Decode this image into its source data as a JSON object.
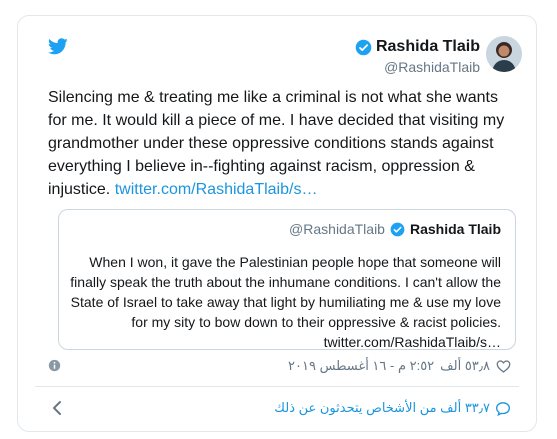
{
  "tweet": {
    "author_name": "Rashida Tlaib",
    "handle": "@RashidaTlaib",
    "text": "Silencing me & treating me like a criminal is not what she wants for me. It would kill a piece of me. I have decided that visiting my grandmother under these oppressive conditions stands against everything I believe in--fighting against racism, oppression & injustice.",
    "link": "twitter.com/RashidaTlaib/s…"
  },
  "quote": {
    "author_name": "Rashida Tlaib",
    "handle": "@RashidaTlaib",
    "text": "When I won, it gave the Palestinian people hope that someone will finally speak the truth about the inhumane conditions. I can't allow the State of Israel to take away that light by humiliating me & use my love for my sity to bow down to their oppressive & racist policies.",
    "link": "twitter.com/RashidaTlaib/s…"
  },
  "meta": {
    "likes": "٥٣٫٨ ألف",
    "timestamp": "٢:٥٢ م - ١٦ أغسطس ٢٠١٩"
  },
  "footer": {
    "replies_text": "٣٣٫٧ ألف من الأشخاص يتحدثون عن ذلك"
  },
  "icons": {
    "bird": "twitter-bird-icon",
    "verified": "verified-badge-icon",
    "info": "info-icon",
    "heart": "heart-icon",
    "chevron": "chevron-left-icon",
    "bubble": "reply-bubble-icon"
  },
  "colors": {
    "brand": "#1da1f2",
    "link": "#1b95e0",
    "muted": "#657786",
    "border": "#e1e8ed"
  }
}
